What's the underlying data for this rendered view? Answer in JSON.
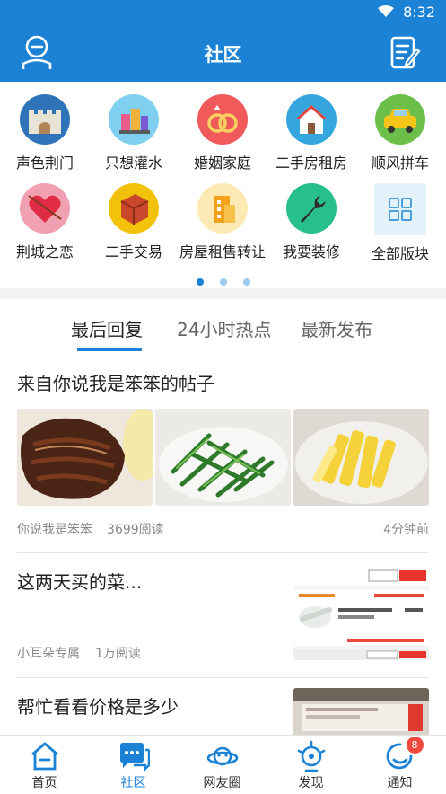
{
  "status_bar": {
    "time": "8:32"
  },
  "app_bar": {
    "title": "社区"
  },
  "categories": [
    {
      "label": "声色荆门",
      "icon": "castle-icon",
      "color": "#2f74b8"
    },
    {
      "label": "只想灌水",
      "icon": "city-icon",
      "color": "#7fd0f0"
    },
    {
      "label": "婚姻家庭",
      "icon": "rings-icon",
      "color": "#f05a5a"
    },
    {
      "label": "二手房租房",
      "icon": "house-icon",
      "color": "#35a6de"
    },
    {
      "label": "顺风拼车",
      "icon": "car-icon",
      "color": "#6cc04a"
    },
    {
      "label": "荆城之恋",
      "icon": "heart-icon",
      "color": "#f0a0b0"
    },
    {
      "label": "二手交易",
      "icon": "box-icon",
      "color": "#f2c20a"
    },
    {
      "label": "房屋租售转让",
      "icon": "building-icon",
      "color": "#fde9b4"
    },
    {
      "label": "我要装修",
      "icon": "wrench-icon",
      "color": "#27c08a"
    },
    {
      "label": "全部版块",
      "icon": "grid-icon",
      "color": "#e3f1fb"
    }
  ],
  "tabs": [
    "最后回复",
    "24小时热点",
    "最新发布"
  ],
  "posts": [
    {
      "title": "来自你说我是笨笨的帖子",
      "author": "你说我是笨笨",
      "views": "3699阅读",
      "time": "4分钟前"
    },
    {
      "title": "这两天买的菜...",
      "author": "小耳朵专属",
      "views": "1万阅读"
    },
    {
      "title": "帮忙看看价格是多少"
    }
  ],
  "nav": [
    {
      "label": "首页",
      "icon": "home-icon"
    },
    {
      "label": "社区",
      "icon": "community-icon"
    },
    {
      "label": "网友圈",
      "icon": "planet-icon"
    },
    {
      "label": "发现",
      "icon": "discover-icon"
    },
    {
      "label": "通知",
      "icon": "notification-icon",
      "badge": "8"
    }
  ],
  "colors": {
    "brand": "#1b82d6",
    "badge": "#f04a3f"
  }
}
